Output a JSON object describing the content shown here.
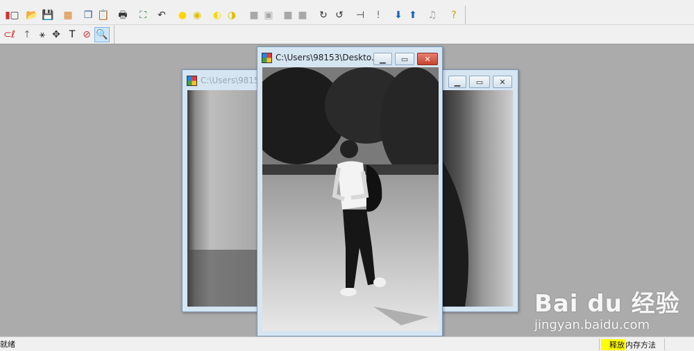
{
  "toolbar_primary": {
    "icons": [
      {
        "name": "stop-icon",
        "glyph": "▮",
        "color": "#d32f2f"
      },
      {
        "name": "new-file-icon",
        "glyph": "▢",
        "color": "#333333"
      },
      {
        "name": "open-folder-icon",
        "glyph": "📂",
        "color": "#c79a2b"
      },
      {
        "name": "save-icon",
        "glyph": "💾",
        "color": "#1f3a93"
      },
      {
        "name": "import-image-icon",
        "glyph": "▦",
        "color": "#d9822b"
      },
      {
        "name": "copy-icon",
        "glyph": "❐",
        "color": "#2d5aa0"
      },
      {
        "name": "paste-icon",
        "glyph": "📋",
        "color": "#7a5a2b"
      },
      {
        "name": "print-icon",
        "glyph": "🖶",
        "color": "#333333"
      },
      {
        "name": "fit-window-icon",
        "glyph": "⛶",
        "color": "#2e7d32"
      },
      {
        "name": "undo-icon",
        "glyph": "↶",
        "color": "#333333"
      },
      {
        "name": "brightness-up-icon",
        "glyph": "●",
        "color": "#ffd600"
      },
      {
        "name": "brightness-down-icon",
        "glyph": "◉",
        "color": "#e0c000"
      },
      {
        "name": "contrast-up-icon",
        "glyph": "◐",
        "color": "#ffd600"
      },
      {
        "name": "contrast-down-icon",
        "glyph": "◑",
        "color": "#e0c000"
      },
      {
        "name": "gray-box-icon-1",
        "glyph": "■",
        "color": "#a8a8a8"
      },
      {
        "name": "gray-box-icon-2",
        "glyph": "▣",
        "color": "#a8a8a8"
      },
      {
        "name": "gray-box-icon-3",
        "glyph": "■",
        "color": "#a8a8a8"
      },
      {
        "name": "gray-box-icon-4",
        "glyph": "■",
        "color": "#a8a8a8"
      },
      {
        "name": "rotate-right-icon",
        "glyph": "↻",
        "color": "#333333"
      },
      {
        "name": "rotate-left-icon",
        "glyph": "↺",
        "color": "#333333"
      },
      {
        "name": "histogram-icon",
        "glyph": "⊣",
        "color": "#333333"
      },
      {
        "name": "info-icon",
        "glyph": "!",
        "color": "#777777"
      },
      {
        "name": "arrow-down-icon",
        "glyph": "⬇",
        "color": "#1565c0"
      },
      {
        "name": "arrow-up-icon",
        "glyph": "⬆",
        "color": "#1565c0"
      },
      {
        "name": "music-note-icon",
        "glyph": "♫",
        "color": "#9e9e9e"
      },
      {
        "name": "help-icon",
        "glyph": "?",
        "color": "#c8a800"
      }
    ]
  },
  "toolbar_secondary": {
    "icons": [
      {
        "name": "select-ellipse-icon",
        "glyph": "⊂",
        "color": "#d32f2f"
      },
      {
        "name": "lasso-icon",
        "glyph": "ℓ",
        "color": "#d32f2f"
      },
      {
        "name": "arrow-pointer-icon",
        "glyph": "↑",
        "color": "#777777"
      },
      {
        "name": "magic-wand-icon",
        "glyph": "⚹",
        "color": "#333333"
      },
      {
        "name": "move-icon",
        "glyph": "✥",
        "color": "#333333"
      },
      {
        "name": "text-tool-icon",
        "glyph": "T",
        "color": "#111111"
      },
      {
        "name": "no-icon",
        "glyph": "⊘",
        "color": "#d32f2f"
      },
      {
        "name": "zoom-icon",
        "glyph": "🔍",
        "color": "#333333"
      }
    ]
  },
  "windows": {
    "back": {
      "title": "C:\\Users\\98153"
    },
    "front": {
      "title": "C:\\Users\\98153\\Deskto..."
    }
  },
  "statusbar": {
    "left": "就绪",
    "right_highlight": "释放",
    "right_rest": "内存方法"
  },
  "watermark": {
    "logo": "Bai du 经验",
    "url": "jingyan.baidu.com"
  }
}
